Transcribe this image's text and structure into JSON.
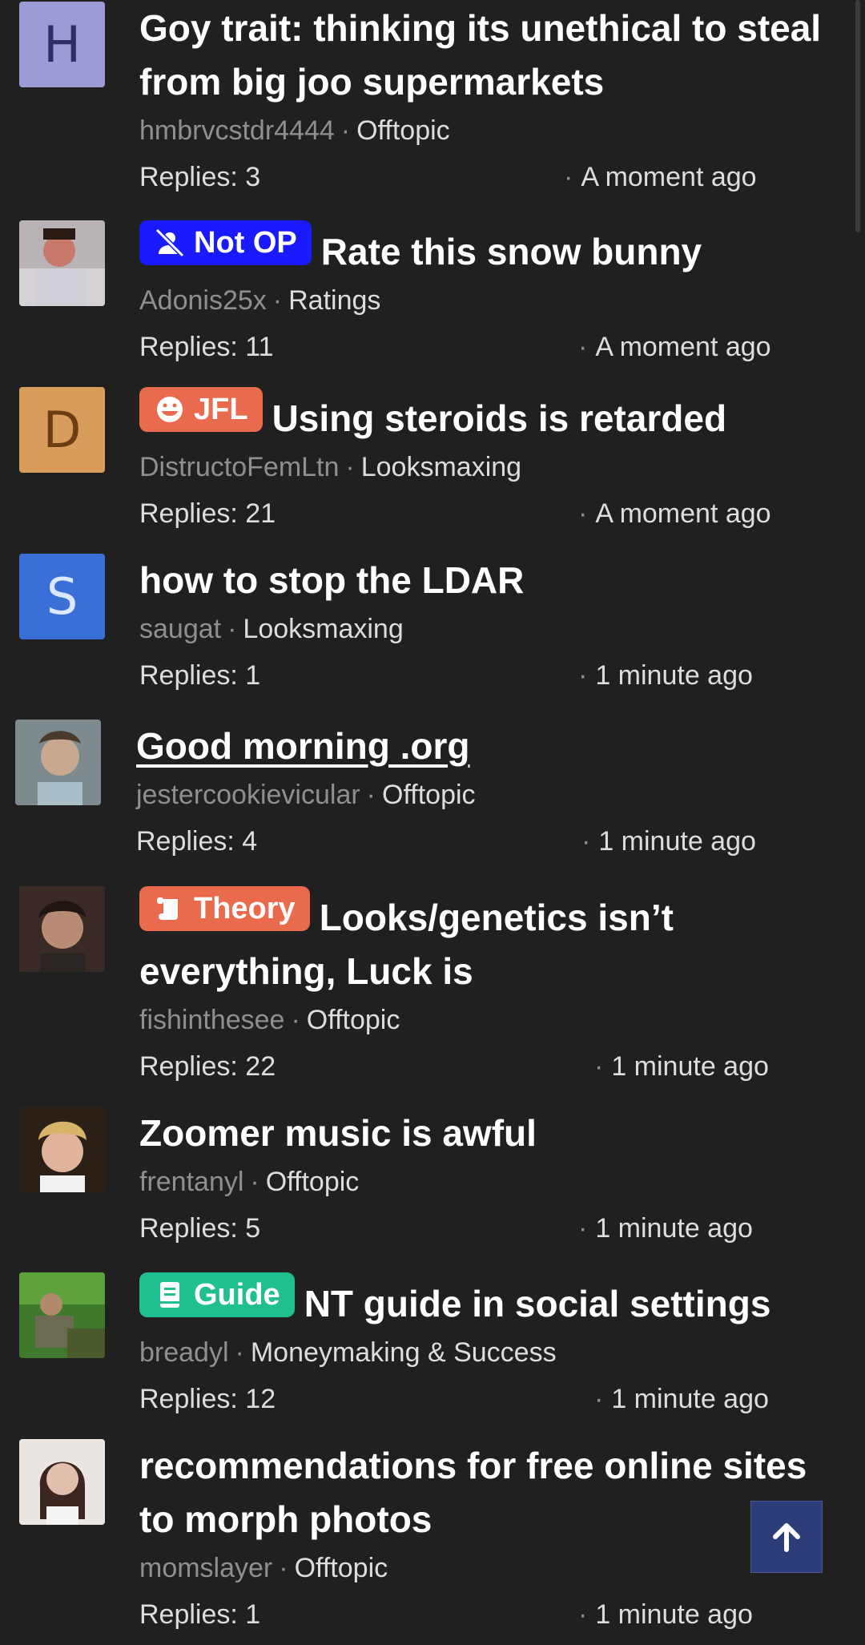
{
  "threads": [
    {
      "avatar_letter": "H",
      "avatar_color": "#9b9bd6",
      "avatar_letter_color": "#2e2e63",
      "badge": null,
      "title": "Goy trait: thinking its unethical to steal from big joo supermarkets",
      "author": "hmbrvcstdr4444",
      "forum": "Offtopic",
      "replies": "Replies: 3",
      "time": "A moment ago"
    },
    {
      "avatar_letter": "",
      "avatar_photo": "avatar-photo-adonis",
      "badge": {
        "label": "Not OP",
        "color": "#1a1aff",
        "icon": "user-slash-icon"
      },
      "title": "Rate this snow bunny",
      "author": "Adonis25x",
      "forum": "Ratings",
      "replies": "Replies: 11",
      "time": "A moment ago"
    },
    {
      "avatar_letter": "D",
      "avatar_color": "#d89d5a",
      "avatar_letter_color": "#6b3d12",
      "badge": {
        "label": "JFL",
        "color": "#ea6a4d",
        "icon": "laugh-icon"
      },
      "title": "Using steroids is retarded",
      "author": "DistructoFemLtn",
      "forum": "Looksmaxing",
      "replies": "Replies: 21",
      "time": "A moment ago"
    },
    {
      "avatar_letter": "S",
      "avatar_color": "#3b6fd8",
      "avatar_letter_color": "#dde8ff",
      "badge": null,
      "title": "how to stop the LDAR",
      "author": "saugat",
      "forum": "Looksmaxing",
      "replies": "Replies: 1",
      "time": "1 minute ago"
    },
    {
      "avatar_letter": "",
      "avatar_photo": "avatar-photo-jestercookievicular",
      "badge": null,
      "title": "Good morning .org",
      "author": "jestercookievicular",
      "forum": "Offtopic",
      "replies": "Replies: 4",
      "time": "1 minute ago",
      "underlined": true
    },
    {
      "avatar_letter": "",
      "avatar_photo": "avatar-photo-fishinthesee",
      "badge": {
        "label": "Theory",
        "color": "#ea6a4d",
        "icon": "scroll-icon"
      },
      "title": "Looks/genetics isn’t everything, Luck is",
      "author": "fishinthesee",
      "forum": "Offtopic",
      "replies": "Replies: 22",
      "time": "1 minute ago"
    },
    {
      "avatar_letter": "",
      "avatar_photo": "avatar-photo-frentanyl",
      "badge": null,
      "title": "Zoomer music is awful",
      "author": "frentanyl",
      "forum": "Offtopic",
      "replies": "Replies: 5",
      "time": "1 minute ago"
    },
    {
      "avatar_letter": "",
      "avatar_photo": "avatar-photo-breadyl",
      "badge": {
        "label": "Guide",
        "color": "#1fbf8f",
        "icon": "book-icon"
      },
      "title": "NT guide in social settings",
      "author": "breadyl",
      "forum": "Moneymaking & Success",
      "replies": "Replies: 12",
      "time": "1 minute ago"
    },
    {
      "avatar_letter": "",
      "avatar_photo": "avatar-photo-momslayer",
      "badge": null,
      "title": "recommendations for free online sites to morph photos",
      "author": "momslayer",
      "forum": "Offtopic",
      "replies": "Replies: 1",
      "time": "1 minute ago"
    }
  ],
  "meta_separator": "·",
  "back_to_top_icon": "arrow-up-icon"
}
